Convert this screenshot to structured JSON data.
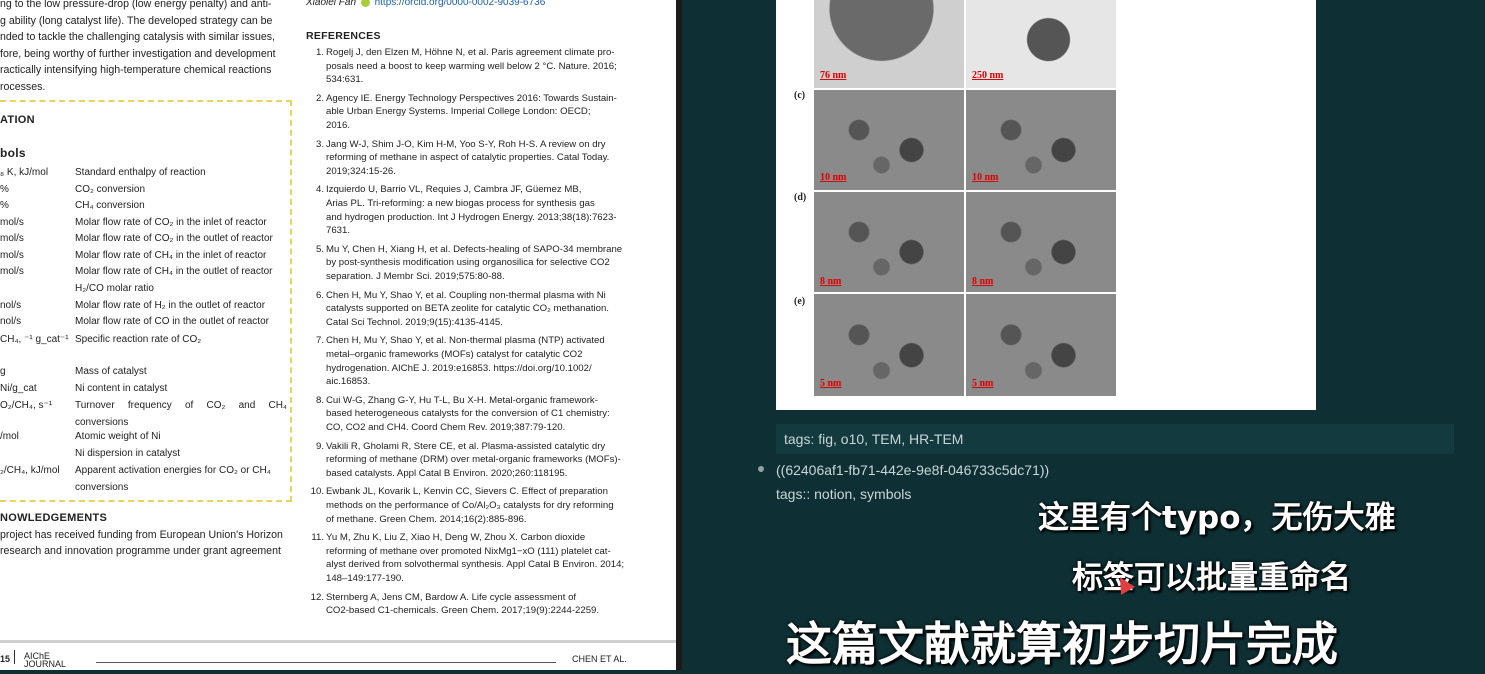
{
  "pdf": {
    "intro_lines": [
      "ng to the low pressure-drop (low energy penalty) and anti-",
      "g ability (long catalyst life). The developed strategy can be",
      "nded to tackle the challenging catalysis with similar issues,",
      "fore, being worthy of further investigation and development",
      "ractically intensifying high-temperature chemical reactions",
      "rocesses."
    ],
    "nomenclature_heading": "ATION",
    "symbols_heading": "bols",
    "symbols": [
      {
        "symbol": "₈ K, kJ/mol",
        "desc": "Standard enthalpy of reaction"
      },
      {
        "symbol": "%",
        "desc": "CO₂ conversion"
      },
      {
        "symbol": "%",
        "desc": "CH₄ conversion"
      },
      {
        "symbol": "mol/s",
        "desc": "Molar flow rate of CO₂ in the inlet of reactor"
      },
      {
        "symbol": "mol/s",
        "desc": "Molar flow rate of CO₂ in the outlet of reactor"
      },
      {
        "symbol": "mol/s",
        "desc": "Molar flow rate of CH₄ in the inlet of reactor"
      },
      {
        "symbol": "mol/s",
        "desc": "Molar flow rate of CH₄ in the outlet of reactor"
      },
      {
        "symbol": "",
        "desc": "H₂/CO molar ratio"
      },
      {
        "symbol": "nol/s",
        "desc": "Molar flow rate of H₂ in the outlet of reactor"
      },
      {
        "symbol": "nol/s",
        "desc": "Molar flow rate of CO in the outlet of reactor"
      },
      {
        "symbol": "CH₄, ⁻¹ g_cat⁻¹",
        "desc": "Specific reaction rate of CO₂"
      },
      {
        "symbol": "g",
        "desc": "Mass of catalyst"
      },
      {
        "symbol": "Ni/g_cat",
        "desc": "Ni content in catalyst"
      },
      {
        "symbol": "O₂/CH₄, s⁻¹",
        "desc": "Turnover frequency of CO₂ and CH₄ conversions"
      },
      {
        "symbol": "/mol",
        "desc": "Atomic weight of Ni"
      },
      {
        "symbol": "",
        "desc": "Ni dispersion in catalyst"
      },
      {
        "symbol": "₂/CH₄, kJ/mol",
        "desc": "Apparent activation energies for CO₂ or CH₄ conversions"
      }
    ],
    "ack_heading": "NOWLEDGEMENTS",
    "ack_lines": [
      "project has received funding from European Union's Horizon",
      "research and innovation programme under grant agreement"
    ],
    "author_line": "Xiaolei Fan",
    "orcid_url": "https://orcid.org/0000-0002-9039-6736",
    "references_heading": "REFERENCES",
    "references": [
      {
        "n": "1.",
        "lines": [
          "Rogelj J, den Elzen M, Höhne N, et al. Paris agreement climate pro-",
          "posals need a boost to keep warming well below 2 °C. Nature. 2016;",
          "534:631."
        ]
      },
      {
        "n": "2.",
        "lines": [
          "Agency IE. Energy Technology Perspectives 2016: Towards Sustain-",
          "able Urban Energy Systems. Imperial College London: OECD;",
          "2016."
        ]
      },
      {
        "n": "3.",
        "lines": [
          "Jang W-J, Shim J-O, Kim H-M, Yoo S-Y, Roh H-S. A review on dry",
          "reforming of methane in aspect of catalytic properties. Catal Today.",
          "2019;324:15-26."
        ]
      },
      {
        "n": "4.",
        "lines": [
          "Izquierdo U, Barrio VL, Requies J, Cambra JF, Güemez MB,",
          "Arias PL. Tri-reforming: a new biogas process for synthesis gas",
          "and hydrogen production. Int J Hydrogen Energy. 2013;38(18):7623-",
          "7631."
        ]
      },
      {
        "n": "5.",
        "lines": [
          "Mu Y, Chen H, Xiang H, et al. Defects-healing of SAPO-34 membrane",
          "by post-synthesis modification using organosilica for selective CO2",
          "separation. J Membr Sci. 2019;575:80-88."
        ]
      },
      {
        "n": "6.",
        "lines": [
          "Chen H, Mu Y, Shao Y, et al. Coupling non-thermal plasma with Ni",
          "catalysts supported on BETA zeolite for catalytic CO₂ methanation.",
          "Catal Sci Technol. 2019;9(15):4135-4145."
        ]
      },
      {
        "n": "7.",
        "lines": [
          "Chen H, Mu Y, Shao Y, et al. Non-thermal plasma (NTP) activated",
          "metal–organic frameworks (MOFs) catalyst for catalytic CO2",
          "hydrogenation. AIChE J. 2019:e16853. https://doi.org/10.1002/",
          "aic.16853."
        ]
      },
      {
        "n": "8.",
        "lines": [
          "Cui W-G, Zhang G-Y, Hu T-L, Bu X-H. Metal-organic framework-",
          "based heterogeneous catalysts for the conversion of C1 chemistry:",
          "CO, CO2 and CH4. Coord Chem Rev. 2019;387:79-120."
        ]
      },
      {
        "n": "9.",
        "lines": [
          "Vakili R, Gholami R, Stere CE, et al. Plasma-assisted catalytic dry",
          "reforming of methane (DRM) over metal-organic frameworks (MOFs)-",
          "based catalysts. Appl Catal B Environ. 2020;260:118195."
        ]
      },
      {
        "n": "10.",
        "lines": [
          "Ewbank JL, Kovarik L, Kenvin CC, Sievers C. Effect of preparation",
          "methods on the performance of Co/Al₂O₃ catalysts for dry reforming",
          "of methane. Green Chem. 2014;16(2):885-896."
        ]
      },
      {
        "n": "11.",
        "lines": [
          "Yu M, Zhu K, Liu Z, Xiao H, Deng W, Zhou X. Carbon dioxide",
          "reforming of methane over promoted NixMg1−xO (111) platelet cat-",
          "alyst derived from solvothermal synthesis. Appl Catal B Environ. 2014;",
          "148–149:177-190."
        ]
      },
      {
        "n": "12.",
        "lines": [
          "Sternberg A, Jens CM, Bardow A. Life cycle assessment of",
          "CO2-based C1-chemicals. Green Chem. 2017;19(9):2244-2259."
        ]
      }
    ],
    "footer_page": "15",
    "footer_journal": "AIChE JOURNAL",
    "footer_author": "CHEN ET AL."
  },
  "figure": {
    "scale_labels": [
      "76 nm",
      "250 nm",
      "10 nm",
      "10 nm",
      "8 nm",
      "8 nm",
      "5 nm",
      "5 nm"
    ],
    "row_labels": [
      "(c)",
      "(d)",
      "(e)"
    ]
  },
  "note": {
    "tags_line": "tags: fig, o10, TEM, HR-TEM",
    "block_ref": "((62406af1-fb71-442e-9e8f-046733c5dc71))",
    "tags_prop": "tags:: notion, symbols"
  },
  "subtitles": {
    "line1": "这里有个typo，无伤大雅",
    "line2": "标签可以批量重命名",
    "line3": "这篇文献就算初步切片完成"
  }
}
